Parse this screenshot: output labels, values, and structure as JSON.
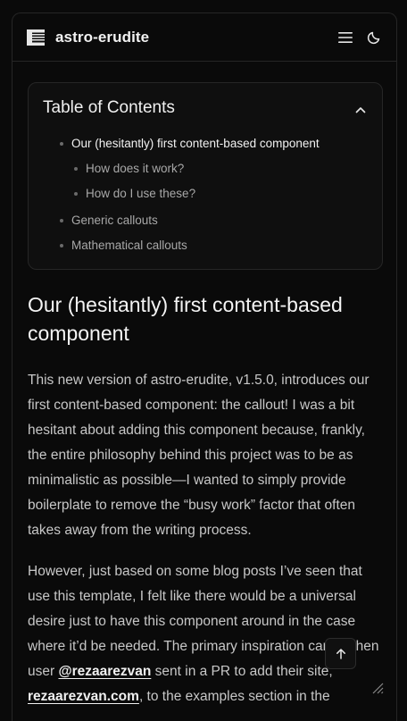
{
  "header": {
    "site_title": "astro-erudite",
    "logo_icon": "stacked-bars-logo-icon",
    "menu_icon": "hamburger-menu-icon",
    "theme_icon": "moon-icon"
  },
  "toc": {
    "title": "Table of Contents",
    "toggle_icon": "chevron-up-icon",
    "items": [
      {
        "label": "Our (hesitantly) first content-based component",
        "level": 1,
        "active": true
      },
      {
        "label": "How does it work?",
        "level": 2,
        "active": false
      },
      {
        "label": "How do I use these?",
        "level": 2,
        "active": false
      },
      {
        "label": "Generic callouts",
        "level": 1,
        "active": false
      },
      {
        "label": "Mathematical callouts",
        "level": 1,
        "active": false
      }
    ]
  },
  "article": {
    "heading": "Our (hesitantly) first content-based component",
    "paragraph1": "This new version of astro-erudite, v1.5.0, introduces our first content-based component: the callout! I was a bit hesitant about adding this component because, frankly, the entire philosophy behind this project was to be as minimalistic as possible—I wanted to simply provide boilerplate to remove the “busy work” factor that often takes away from the writing process.",
    "paragraph2_before": "However, just based on some blog posts I’ve seen that use this template, I felt like there would be a universal desire just to have this component around in the case where it’d be needed. The primary inspiration came when user ",
    "link1": "@rezaarezvan",
    "paragraph2_middle": " sent in a PR to add their site, ",
    "link2": "rezaarezvan.com",
    "paragraph2_after": ", to the examples section in the"
  },
  "controls": {
    "back_to_top_icon": "arrow-up-icon",
    "resize_icon": "resize-grip-icon"
  }
}
